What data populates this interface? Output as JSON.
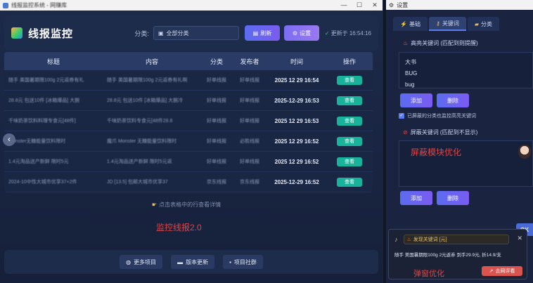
{
  "main_window": {
    "title": "线报监控系统 - 网赚库",
    "controls": {
      "minimize": "—",
      "maximize": "☐",
      "close": "✕"
    }
  },
  "header": {
    "app_title": "线报监控",
    "category_label": "分类:",
    "category_value": "全部分类",
    "refresh_label": "刷新",
    "settings_label": "设置",
    "updated_text": "更新于 16:54:16"
  },
  "table": {
    "columns": [
      "标题",
      "内容",
      "分类",
      "发布者",
      "时间",
      "操作"
    ],
    "rows": [
      {
        "title": "随手 美国暑期限100g 2元返券有礼",
        "content": "随手 美国暑期限100g 2元返券有礼啊",
        "category": "好单线报",
        "publisher": "好单线报",
        "time": "2025 12 29 16:54",
        "action": "查看"
      },
      {
        "title": "28.8元 包送10件 [冰箱爆品] 大腕",
        "content": "28.8元 包送10件 [冰箱爆品] 大腕冷",
        "category": "好单线报",
        "publisher": "好单线报",
        "time": "2025-12-29 16:53",
        "action": "查看"
      },
      {
        "title": "千味奶茶饮料料理专食元[48件]",
        "content": "千味奶茶饮料专食元[48件28.8",
        "category": "好单线报",
        "publisher": "好单线报",
        "time": "2025 12 29 16:53",
        "action": "查看"
      },
      {
        "title": "Monster无糖能量饮料限时",
        "content": "魔爪 Monster 无糖能量饮料限时",
        "category": "好单线报",
        "publisher": "必胜线报",
        "time": "2025 12 29 16:52",
        "action": "查看"
      },
      {
        "title": "1.4元淘品送产新鲜 限时5元",
        "content": "1.4元淘品送产新鲜 限时5元返",
        "category": "好单线报",
        "publisher": "好单线报",
        "time": "2025 12 29 16:52",
        "action": "查看"
      },
      {
        "title": "2024-10中性大城市优享37+2件",
        "content": "JD [13.5] 包邮大城市优享37",
        "category": "京东线报",
        "publisher": "京东线报",
        "time": "2025-12-29 16:52",
        "action": "查看"
      }
    ]
  },
  "hint_text": "点击表格中的行查看详情",
  "overlay_main": "监控线报2.0",
  "footer": {
    "more_projects": "更多项目",
    "version_update": "版本更新",
    "project_community": "项目社群"
  },
  "settings_panel": {
    "title": "设置",
    "tabs": [
      "基础",
      "关键词",
      "分类"
    ],
    "active_tab": 1,
    "keywords_title": "高亮关键词 (匹配到则提醒)",
    "keywords": [
      "大书",
      "BUG",
      "bug"
    ],
    "add_label": "添加",
    "delete_label": "删除",
    "checkbox_label": "已屏蔽的分类也监控高亮关键词",
    "block_title": "屏蔽关键词 (匹配到不显示)",
    "block_overlay": "屏蔽模块优化",
    "ok_label": "OK"
  },
  "popup": {
    "head_label": "发现关键词",
    "keyword_value": "发现关键词 [元]",
    "body": "随手 美国暑期限100g 2元返券 到手29.9元, 折14.9/支",
    "button_label": "去网评看",
    "overlay": "弹窗优化"
  },
  "icons": {
    "refresh": "refresh-icon",
    "settings": "gear-icon",
    "bell": "bell-icon"
  },
  "colors": {
    "accent": "#5b6cf0",
    "view_button": "#19b39b",
    "overlay_text": "#e34444"
  }
}
